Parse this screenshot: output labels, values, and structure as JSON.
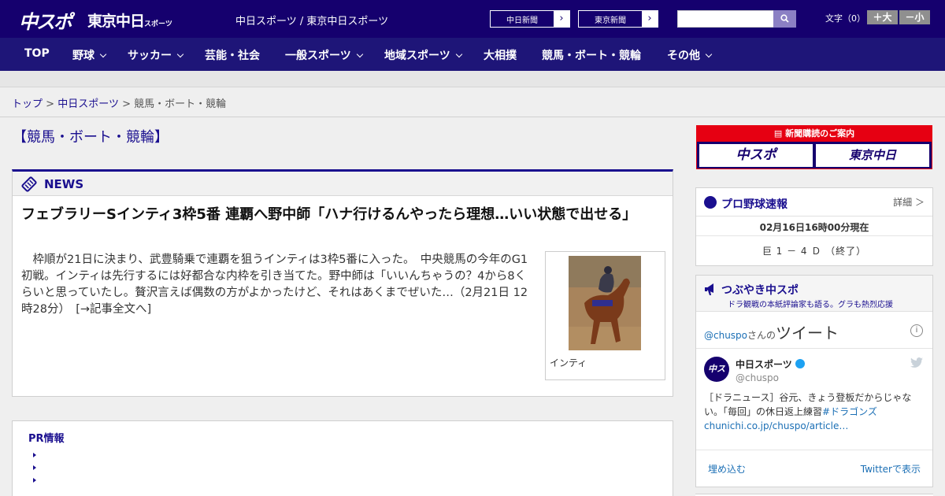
{
  "header": {
    "logo_chuspo": "中スポ",
    "logo_tokyo": "東京中日",
    "logo_tokyo_small": "スポーツ",
    "sites_text": "中日スポーツ / 東京中日スポーツ",
    "site_buttons": [
      "中日新聞",
      "東京新聞"
    ],
    "fontsize_label": "文字（0）",
    "font_larger": "＋大",
    "font_smaller": "－小"
  },
  "nav": {
    "items": [
      {
        "label": "TOP"
      },
      {
        "label": "野球"
      },
      {
        "label": "サッカー"
      },
      {
        "label": "芸能・社会"
      },
      {
        "label": "一般スポーツ"
      },
      {
        "label": "地域スポーツ"
      },
      {
        "label": "大相撲"
      },
      {
        "label": "競馬・ボート・競輪"
      },
      {
        "label": "その他"
      }
    ]
  },
  "breadcrumb": {
    "items": [
      "トップ",
      "中日スポーツ",
      "競馬・ボート・競輪"
    ],
    "separator": ">"
  },
  "page_title": "【競馬・ボート・競輪】",
  "news": {
    "label": "NEWS",
    "headline": "フェブラリーSインティ3枠5番 連覇へ野中師「ハナ行けるんやったら理想…いい状態で出せる」",
    "summary": "　枠順が21日に決まり、武豊騎乗で連覇を狙うインティは3枠5番に入った。　中央競馬の今年のG1初戦。インティは先行するには好都合な内枠を引き当てた。野中師は「いいんちゃうの？4から8くらいと思っていたし。贅沢言えば偶数の方がよかったけど、それはあくまでぜいた…（2月21日 12時28分）　[→記事全文へ]",
    "photo_caption": "インティ"
  },
  "pr": {
    "title": "PR情報"
  },
  "sidebar": {
    "subscribe": {
      "title": "新聞購読のご案内",
      "logos": [
        "中スポ",
        "東京中日"
      ]
    },
    "baseball": {
      "title": "プロ野球速報",
      "detail": "詳細 ＞",
      "time": "02月16日16時00分現在",
      "score": "巨 1 － 4 Ｄ （終了）"
    },
    "tsubuyaki": {
      "title": "つぶやき中スポ",
      "subtitle": "ドラ観戦の本紙評論家も語る。グラも熱烈応援",
      "handle": "@chuspo",
      "handle_suffix": "さんの",
      "tweets_label": "ツイート",
      "info": "i",
      "account_name": "中日スポーツ",
      "account_handle": "@chuspo",
      "avatar_text": "中スポ",
      "tweet_text": "［ドラニュース］谷元、きょう登板だからじゃない。「毎回」の休日返上練習",
      "tweet_hashtag": "#ドラゴンズ",
      "tweet_link": "chunichi.co.jp/chuspo/article…",
      "embed": "埋め込む",
      "view_on_twitter": "Twitterで表示"
    }
  },
  "colors": {
    "header_bg": "#15006e",
    "nav_bg": "#1e1578",
    "accent": "#1a0f8f",
    "subscribe_red": "#e60012",
    "link": "#1b6fb5"
  }
}
